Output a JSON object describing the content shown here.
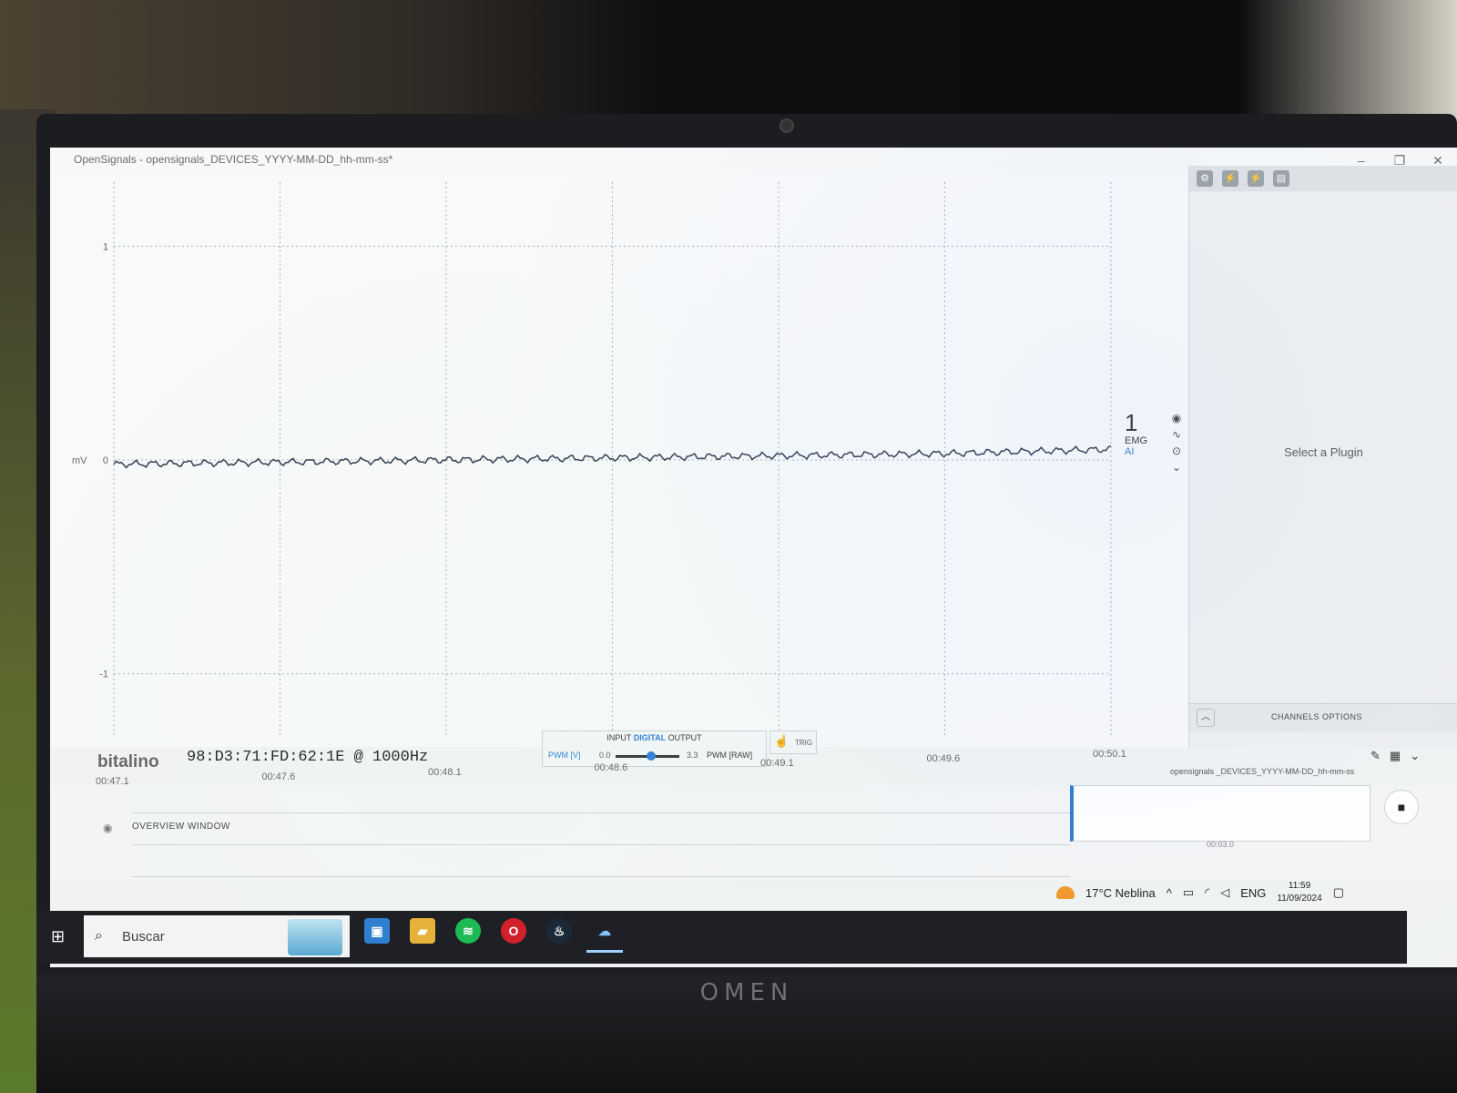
{
  "window": {
    "title": "OpenSignals - opensignals_DEVICES_YYYY-MM-DD_hh-mm-ss*",
    "controls": [
      "–",
      "❐",
      "✕"
    ]
  },
  "plot": {
    "ylabel": "mV",
    "yticks": [
      "1",
      "0",
      "-1"
    ],
    "xticks": [
      "00:47.1",
      "00:47.6",
      "00:48.1",
      "00:48.6",
      "00:49.1",
      "00:49.6",
      "00:50.1"
    ],
    "trace_color": "#2e3a4f"
  },
  "chart_data": {
    "type": "line",
    "xlabel": "",
    "ylabel": "mV",
    "x": [
      "00:47.1",
      "00:47.6",
      "00:48.1",
      "00:48.6",
      "00:49.1",
      "00:49.6",
      "00:50.1"
    ],
    "series": [
      {
        "values": [
          -0.02,
          -0.01,
          0.0,
          0.01,
          0.02,
          0.03,
          0.05
        ]
      }
    ],
    "ylim": [
      -1.3,
      1.3
    ],
    "grid": true
  },
  "channel": {
    "number": "1",
    "type": "EMG",
    "input": "AI",
    "icons": [
      "eye-icon",
      "wave-icon",
      "record-icon",
      "chevron-down-icon"
    ]
  },
  "side_panel": {
    "toolbar_icons": [
      "gear-icon",
      "plug-icon",
      "plug-icon-2",
      "chart-icon"
    ],
    "message": "Select a Plugin",
    "channels_label": "CHANNELS OPTIONS"
  },
  "status": {
    "logo": "bitalino",
    "device": "98:D3:71:FD:62:1E @ 1000Hz",
    "io_input": "INPUT",
    "io_digital": "DIGITAL",
    "io_output": "OUTPUT",
    "pwm_v": "PWM [V]",
    "pwm_min": "0.0",
    "pwm_max": "3.3",
    "pwm_raw": "PWM [RAW]",
    "pwm_level": 0.55,
    "trig": "TRIG"
  },
  "overview": {
    "label": "OVERVIEW WINDOW",
    "file": "opensignals _DEVICES_YYYY-MM-DD_hh-mm-ss",
    "time": "00:03.0"
  },
  "taskbar": {
    "weather": "17°C Neblina",
    "language": "ENG",
    "time": "11:59",
    "date": "11/09/2024",
    "search_placeholder": "Buscar",
    "apps": [
      "file-explorer-icon",
      "folder-icon",
      "spotify-icon",
      "opera-icon",
      "steam-icon",
      "onedrive-icon"
    ]
  },
  "laptop": {
    "brand": "OMEN"
  }
}
